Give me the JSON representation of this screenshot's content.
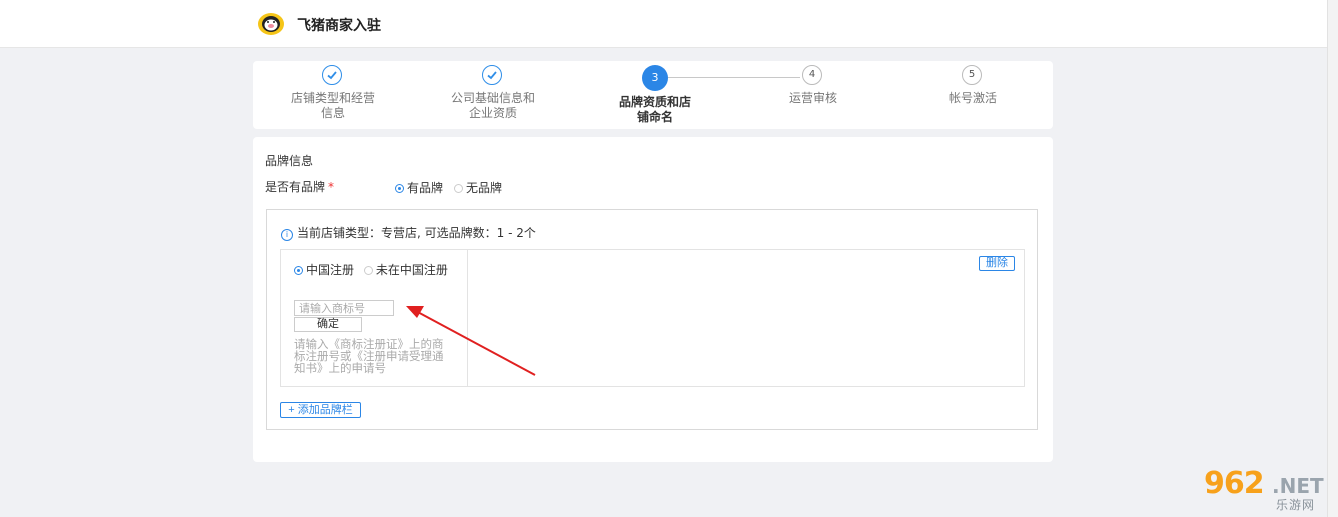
{
  "header": {
    "title": "飞猪商家入驻",
    "logo_icon": "fliggy-pig-logo-icon"
  },
  "steps": [
    {
      "number": "1",
      "label": "店铺类型和经营信息",
      "state": "done"
    },
    {
      "number": "2",
      "label": "公司基础信息和企业资质",
      "state": "done"
    },
    {
      "number": "3",
      "label": "品牌资质和店铺命名",
      "state": "active"
    },
    {
      "number": "4",
      "label": "运营审核",
      "state": "pending"
    },
    {
      "number": "5",
      "label": "帐号激活",
      "state": "pending"
    }
  ],
  "form": {
    "section_title": "品牌信息",
    "brand_question": "是否有品牌",
    "required_mark": "*",
    "brand_options": [
      {
        "label": "有品牌",
        "selected": true
      },
      {
        "label": "无品牌",
        "selected": false
      }
    ],
    "info_text": "当前店铺类型：专营店, 可选品牌数：1 - 2个",
    "registration_options": [
      {
        "label": "中国注册",
        "selected": true
      },
      {
        "label": "未在中国注册",
        "selected": false
      }
    ],
    "trademark_input": {
      "value": "",
      "placeholder": "请输入商标号"
    },
    "confirm_label": "确定",
    "hint_text": "请输入《商标注册证》上的商标注册号或《注册申请受理通知书》上的申请号",
    "delete_label": "删除",
    "add_brand_label": "+ 添加品牌栏"
  },
  "watermark": {
    "number": "962",
    "suffix": ".NET",
    "subtitle": "乐游网"
  },
  "colors": {
    "accent": "#2b86e6",
    "required": "#e33333",
    "annotation_arrow": "#e02020",
    "watermark_orange": "#f7a11b"
  }
}
